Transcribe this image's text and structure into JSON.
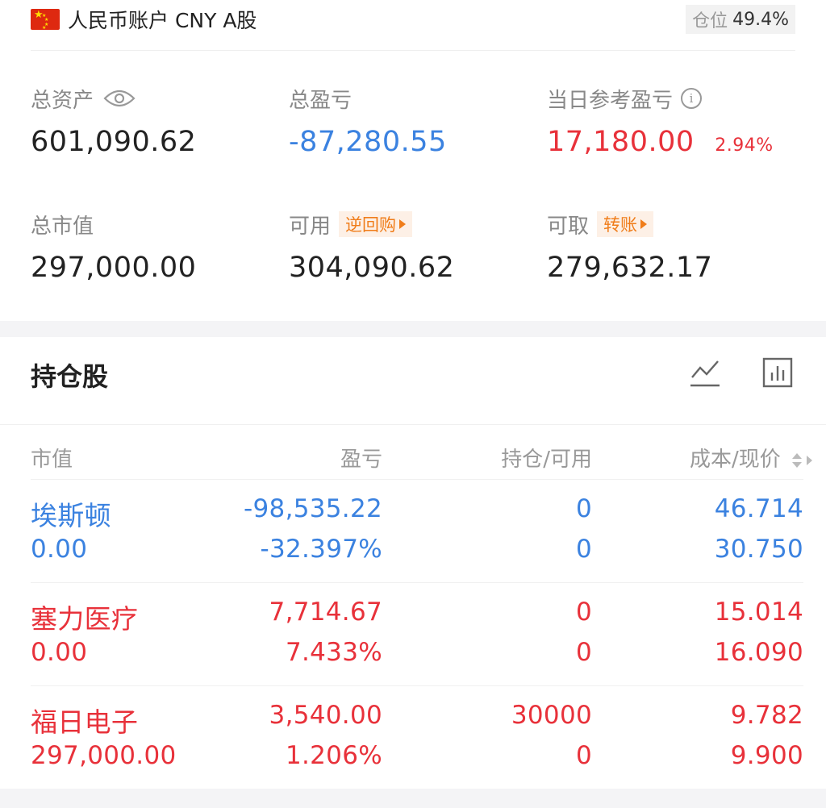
{
  "account": {
    "name": "人民币账户 CNY A股",
    "position_label": "仓位",
    "position_value": "49.4%"
  },
  "summary": {
    "total_assets_label": "总资产",
    "total_assets_value": "601,090.62",
    "total_pnl_label": "总盈亏",
    "total_pnl_value": "-87,280.55",
    "daily_pnl_label": "当日参考盈亏",
    "daily_pnl_value": "17,180.00",
    "daily_pnl_pct": "2.94%",
    "market_value_label": "总市值",
    "market_value_value": "297,000.00",
    "available_label": "可用",
    "available_tag": "逆回购",
    "available_value": "304,090.62",
    "withdrawable_label": "可取",
    "withdrawable_tag": "转账",
    "withdrawable_value": "279,632.17"
  },
  "holdings": {
    "title": "持仓股",
    "columns": [
      "市值",
      "盈亏",
      "持仓/可用",
      "成本/现价"
    ],
    "rows": [
      {
        "name": "埃斯顿",
        "market_value": "0.00",
        "pnl": "-98,535.22",
        "pnl_pct": "-32.397%",
        "holding": "0",
        "available": "0",
        "cost": "46.714",
        "price": "30.750",
        "color": "#3b82e0"
      },
      {
        "name": "塞力医疗",
        "market_value": "0.00",
        "pnl": "7,714.67",
        "pnl_pct": "7.433%",
        "holding": "0",
        "available": "0",
        "cost": "15.014",
        "price": "16.090",
        "color": "#e8313a"
      },
      {
        "name": "福日电子",
        "market_value": "297,000.00",
        "pnl": "3,540.00",
        "pnl_pct": "1.206%",
        "holding": "30000",
        "available": "0",
        "cost": "9.782",
        "price": "9.900",
        "color": "#e8313a"
      }
    ]
  },
  "icons": {
    "flag": "china-flag-icon",
    "eye": "eye-icon",
    "info": "info-icon",
    "line_chart": "line-chart-icon",
    "bar_chart": "bar-chart-icon",
    "sort": "sort-icon"
  },
  "colors": {
    "up": "#e8313a",
    "down": "#3b82e0",
    "tag": "#f07d1a"
  }
}
